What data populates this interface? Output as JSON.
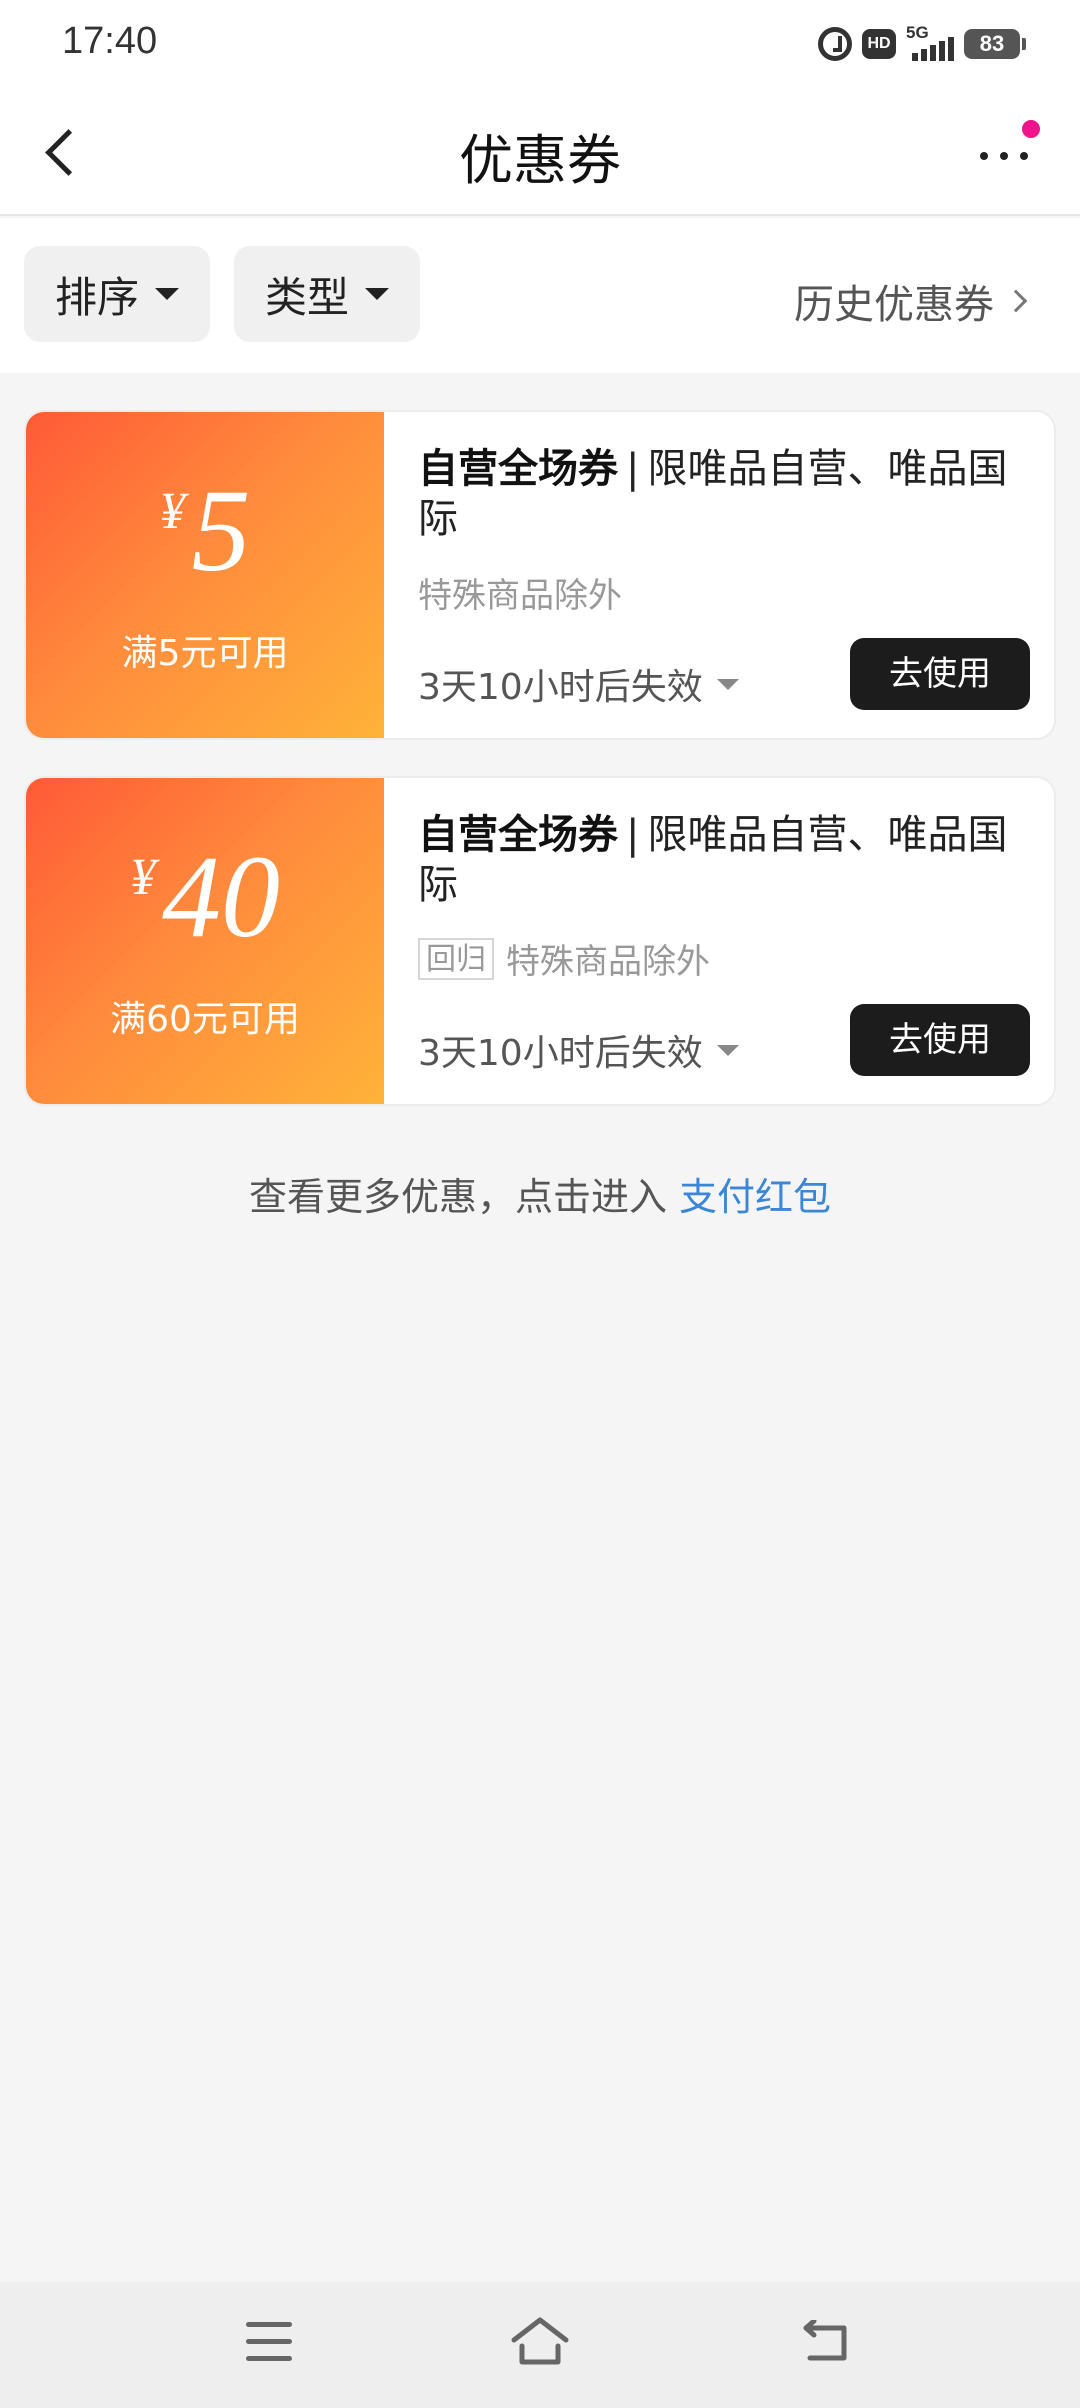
{
  "status_bar": {
    "time": "17:40",
    "network": "5G",
    "hd_label": "HD",
    "battery": "83",
    "icons": [
      "alarm-icon",
      "hd-icon",
      "signal-icon",
      "battery-icon"
    ]
  },
  "header": {
    "title": "优惠券",
    "back_icon": "chevron-left-icon",
    "more_icon": "more-dots-icon",
    "badge_color": "#f0148c"
  },
  "filters": {
    "sort_label": "排序",
    "type_label": "类型",
    "history_label": "历史优惠券"
  },
  "coupons": [
    {
      "currency": "¥",
      "amount": "5",
      "condition": "满5元可用",
      "title_bold": "自营全场券",
      "separator": "|",
      "title_rest": "限唯品自营、唯品国际",
      "tag": "",
      "note": "特殊商品除外",
      "expire": "3天10小时后失效",
      "button": "去使用"
    },
    {
      "currency": "¥",
      "amount": "40",
      "condition": "满60元可用",
      "title_bold": "自营全场券",
      "separator": "|",
      "title_rest": "限唯品自营、唯品国际",
      "tag": "回归",
      "note": "特殊商品除外",
      "expire": "3天10小时后失效",
      "button": "去使用"
    }
  ],
  "footer_hint": {
    "text": "查看更多优惠，点击进入",
    "link": "支付红包",
    "link_color": "#3b86d6"
  },
  "colors": {
    "coupon_gradient_start": "#ff5a36",
    "coupon_gradient_end": "#ffb33a",
    "button_bg": "#1c1c1c"
  },
  "system_nav": {
    "icons": [
      "menu-icon",
      "home-icon",
      "back-icon"
    ]
  }
}
